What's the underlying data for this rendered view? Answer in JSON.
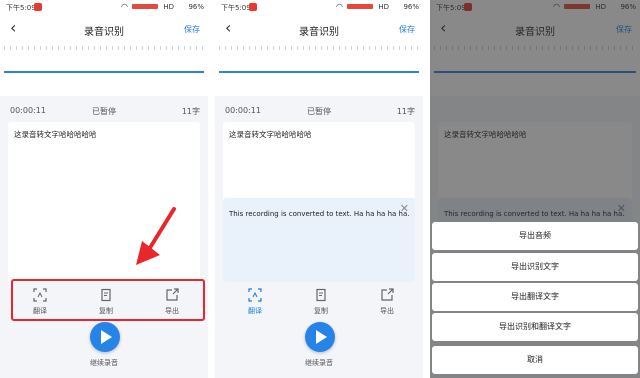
{
  "status": {
    "time": "下午5:09",
    "hd": "HD",
    "battery": "96%"
  },
  "header": {
    "title": "录音识别",
    "save": "保存"
  },
  "info": {
    "duration": "00:00:11",
    "state": "已暂停",
    "count": "11字"
  },
  "transcript": "这录音转文字哈哈哈哈哈",
  "translation": "This recording is converted to text. Ha ha ha ha ha.",
  "toolbar": {
    "translate": "翻译",
    "copy": "复制",
    "export": "导出"
  },
  "continue": "继续录音",
  "sheet": {
    "items": [
      "导出音频",
      "导出识别文字",
      "导出翻译文字",
      "导出识别和翻译文字",
      "取消"
    ]
  },
  "colors": {
    "accent": "#1b7de6",
    "highlight": "#e8262b",
    "translation_bg": "#e9f1fb"
  }
}
